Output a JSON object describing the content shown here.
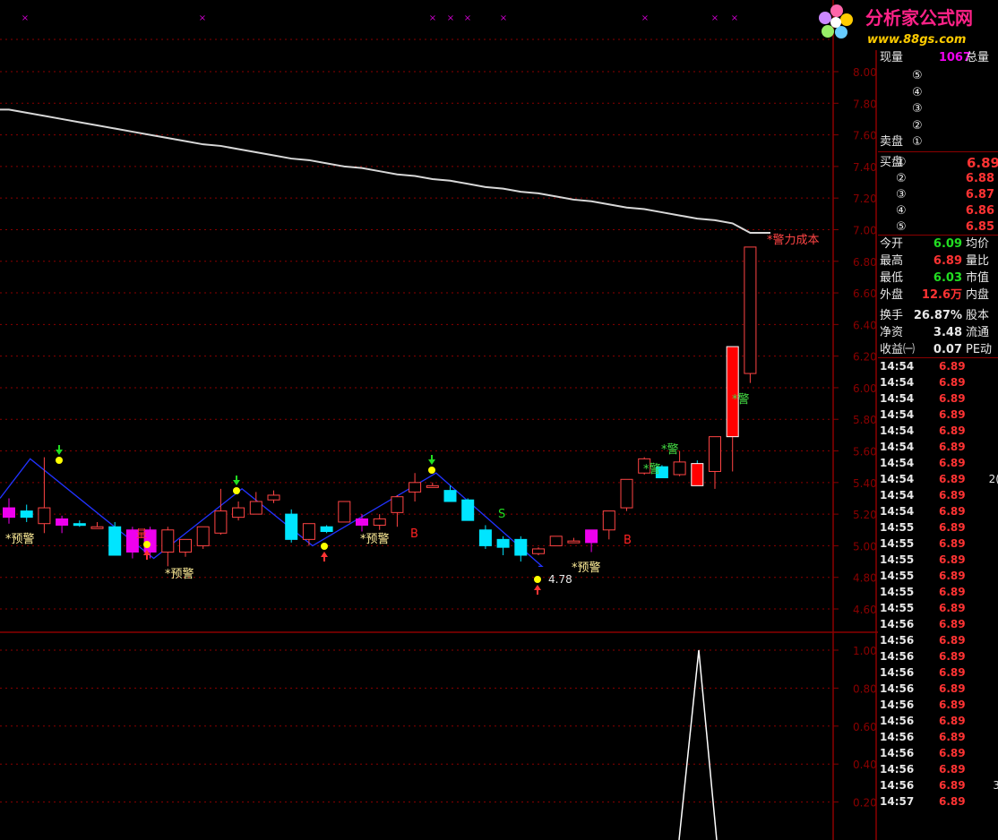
{
  "colors": {
    "up": "#ff4444",
    "down": "#00e5ff",
    "pink": "#ee00ee",
    "grid": "#8b0000",
    "ma": "#d8d8d8"
  },
  "logo": {
    "title": "分析家公式网",
    "url": "www.88gs.com"
  },
  "price_axis": [
    "8.00",
    "7.80",
    "7.60",
    "7.40",
    "7.20",
    "7.00",
    "6.80",
    "6.60",
    "6.40",
    "6.20",
    "6.00",
    "5.80",
    "5.60",
    "5.40",
    "5.20",
    "5.00",
    "4.80",
    "4.60"
  ],
  "indicator_axis": [
    "1.00",
    "0.80",
    "0.60",
    "0.40",
    "0.20"
  ],
  "annotations": {
    "warn": "*预警",
    "alert": "*警",
    "cost": "*警力成本",
    "low_value": "4.78",
    "buy": "B",
    "sell": "S",
    "volume_mark": "量"
  },
  "quote": {
    "current_vol_label": "现量",
    "current_vol": "1067",
    "total_vol_label": "总量",
    "sell_label": "卖盘",
    "buy_label": "买盘",
    "sell_levels": [
      "⑤",
      "④",
      "③",
      "②",
      "①"
    ],
    "buy_levels": [
      {
        "n": "①",
        "price": "6.89"
      },
      {
        "n": "②",
        "price": "6.88"
      },
      {
        "n": "③",
        "price": "6.87"
      },
      {
        "n": "④",
        "price": "6.86"
      },
      {
        "n": "⑤",
        "price": "6.85"
      }
    ],
    "stats": [
      {
        "label": "今开",
        "value": "6.09",
        "color": "#22dd22",
        "label2": "均价"
      },
      {
        "label": "最高",
        "value": "6.89",
        "color": "#ff3333",
        "label2": "量比"
      },
      {
        "label": "最低",
        "value": "6.03",
        "color": "#22dd22",
        "label2": "市值"
      },
      {
        "label": "外盘",
        "value": "12.6万",
        "color": "#ff3333",
        "label2": "内盘"
      },
      {
        "label": "换手",
        "value": "26.87%",
        "color": "#e8e8e8",
        "label2": "股本"
      },
      {
        "label": "净资",
        "value": "3.48",
        "color": "#e8e8e8",
        "label2": "流通"
      },
      {
        "label": "收益㈠",
        "value": "0.07",
        "color": "#e8e8e8",
        "label2": "PE动"
      }
    ],
    "ticks": [
      {
        "t": "14:54",
        "p": "6.89",
        "v": ""
      },
      {
        "t": "14:54",
        "p": "6.89",
        "v": ""
      },
      {
        "t": "14:54",
        "p": "6.89",
        "v": ""
      },
      {
        "t": "14:54",
        "p": "6.89",
        "v": ""
      },
      {
        "t": "14:54",
        "p": "6.89",
        "v": ""
      },
      {
        "t": "14:54",
        "p": "6.89",
        "v": ""
      },
      {
        "t": "14:54",
        "p": "6.89",
        "v": ""
      },
      {
        "t": "14:54",
        "p": "6.89",
        "v": "2("
      },
      {
        "t": "14:54",
        "p": "6.89",
        "v": ""
      },
      {
        "t": "14:54",
        "p": "6.89",
        "v": ""
      },
      {
        "t": "14:55",
        "p": "6.89",
        "v": ""
      },
      {
        "t": "14:55",
        "p": "6.89",
        "v": ""
      },
      {
        "t": "14:55",
        "p": "6.89",
        "v": ""
      },
      {
        "t": "14:55",
        "p": "6.89",
        "v": ""
      },
      {
        "t": "14:55",
        "p": "6.89",
        "v": ""
      },
      {
        "t": "14:55",
        "p": "6.89",
        "v": ""
      },
      {
        "t": "14:56",
        "p": "6.89",
        "v": ""
      },
      {
        "t": "14:56",
        "p": "6.89",
        "v": ""
      },
      {
        "t": "14:56",
        "p": "6.89",
        "v": ""
      },
      {
        "t": "14:56",
        "p": "6.89",
        "v": ""
      },
      {
        "t": "14:56",
        "p": "6.89",
        "v": ""
      },
      {
        "t": "14:56",
        "p": "6.89",
        "v": ""
      },
      {
        "t": "14:56",
        "p": "6.89",
        "v": ""
      },
      {
        "t": "14:56",
        "p": "6.89",
        "v": ""
      },
      {
        "t": "14:56",
        "p": "6.89",
        "v": ""
      },
      {
        "t": "14:56",
        "p": "6.89",
        "v": ""
      },
      {
        "t": "14:56",
        "p": "6.89",
        "v": "3"
      },
      {
        "t": "14:57",
        "p": "6.89",
        "v": ""
      }
    ]
  },
  "chart_data": {
    "type": "candlestick",
    "ylim": [
      4.52,
      8.1
    ],
    "indicator_ylim": [
      0,
      1.04
    ],
    "candles": [
      {
        "o": 5.18,
        "h": 5.3,
        "l": 5.14,
        "c": 5.24
      },
      {
        "o": 5.22,
        "h": 5.26,
        "l": 5.15,
        "c": 5.18
      },
      {
        "o": 5.14,
        "h": 5.56,
        "l": 5.08,
        "c": 5.24
      },
      {
        "o": 5.17,
        "h": 5.19,
        "l": 5.08,
        "c": 5.13
      },
      {
        "o": 5.14,
        "h": 5.16,
        "l": 5.12,
        "c": 5.13
      },
      {
        "o": 5.12,
        "h": 5.15,
        "l": 5.11,
        "c": 5.12
      },
      {
        "o": 5.12,
        "h": 5.15,
        "l": 4.96,
        "c": 4.94
      },
      {
        "o": 5.1,
        "h": 5.12,
        "l": 4.92,
        "c": 4.96
      },
      {
        "o": 4.96,
        "h": 5.12,
        "l": 4.92,
        "c": 5.1
      },
      {
        "o": 4.96,
        "h": 5.12,
        "l": 4.87,
        "c": 5.1
      },
      {
        "o": 4.96,
        "h": 5.04,
        "l": 4.93,
        "c": 5.04
      },
      {
        "o": 5.0,
        "h": 5.12,
        "l": 4.98,
        "c": 5.12
      },
      {
        "o": 5.08,
        "h": 5.36,
        "l": 5.07,
        "c": 5.22
      },
      {
        "o": 5.18,
        "h": 5.28,
        "l": 5.16,
        "c": 5.24
      },
      {
        "o": 5.2,
        "h": 5.34,
        "l": 5.2,
        "c": 5.28
      },
      {
        "o": 5.29,
        "h": 5.35,
        "l": 5.27,
        "c": 5.32
      },
      {
        "o": 5.2,
        "h": 5.23,
        "l": 5.02,
        "c": 5.04
      },
      {
        "o": 5.04,
        "h": 5.14,
        "l": 5.0,
        "c": 5.14
      },
      {
        "o": 5.12,
        "h": 5.13,
        "l": 5.08,
        "c": 5.09
      },
      {
        "o": 5.15,
        "h": 5.28,
        "l": 5.15,
        "c": 5.28
      },
      {
        "o": 5.17,
        "h": 5.2,
        "l": 5.09,
        "c": 5.13
      },
      {
        "o": 5.13,
        "h": 5.2,
        "l": 5.1,
        "c": 5.17
      },
      {
        "o": 5.21,
        "h": 5.32,
        "l": 5.12,
        "c": 5.31
      },
      {
        "o": 5.34,
        "h": 5.46,
        "l": 5.28,
        "c": 5.4
      },
      {
        "o": 5.38,
        "h": 5.4,
        "l": 5.38,
        "c": 5.38
      },
      {
        "o": 5.35,
        "h": 5.38,
        "l": 5.28,
        "c": 5.28
      },
      {
        "o": 5.29,
        "h": 5.3,
        "l": 5.16,
        "c": 5.16
      },
      {
        "o": 5.1,
        "h": 5.13,
        "l": 4.98,
        "c": 5.0
      },
      {
        "o": 5.04,
        "h": 5.06,
        "l": 4.94,
        "c": 4.99
      },
      {
        "o": 5.04,
        "h": 5.06,
        "l": 4.9,
        "c": 4.94
      },
      {
        "o": 4.95,
        "h": 4.99,
        "l": 4.94,
        "c": 4.98
      },
      {
        "o": 5.0,
        "h": 5.06,
        "l": 5.0,
        "c": 5.06
      },
      {
        "o": 5.03,
        "h": 5.05,
        "l": 5.02,
        "c": 5.03
      },
      {
        "o": 5.02,
        "h": 5.08,
        "l": 4.96,
        "c": 5.1
      },
      {
        "o": 5.1,
        "h": 5.22,
        "l": 5.04,
        "c": 5.22
      },
      {
        "o": 5.24,
        "h": 5.42,
        "l": 5.22,
        "c": 5.42
      },
      {
        "o": 5.46,
        "h": 5.56,
        "l": 5.45,
        "c": 5.55
      },
      {
        "o": 5.5,
        "h": 5.51,
        "l": 5.44,
        "c": 5.43
      },
      {
        "o": 5.45,
        "h": 5.6,
        "l": 5.44,
        "c": 5.53
      },
      {
        "o": 5.52,
        "h": 5.54,
        "l": 5.38,
        "c": 5.38
      },
      {
        "o": 5.47,
        "h": 5.69,
        "l": 5.36,
        "c": 5.69
      },
      {
        "o": 5.69,
        "h": 6.14,
        "l": 5.47,
        "c": 6.26
      },
      {
        "o": 6.09,
        "h": 6.89,
        "l": 6.03,
        "c": 6.89
      }
    ],
    "ma": [
      7.76,
      7.74,
      7.72,
      7.7,
      7.68,
      7.66,
      7.64,
      7.62,
      7.6,
      7.58,
      7.56,
      7.54,
      7.53,
      7.51,
      7.49,
      7.47,
      7.45,
      7.44,
      7.42,
      7.4,
      7.39,
      7.37,
      7.35,
      7.34,
      7.32,
      7.31,
      7.29,
      7.27,
      7.26,
      7.24,
      7.23,
      7.21,
      7.19,
      7.18,
      7.16,
      7.14,
      7.13,
      7.11,
      7.09,
      7.07,
      7.06,
      7.04,
      6.98
    ],
    "zigzag": [
      [
        1,
        5.55
      ],
      [
        8,
        4.92
      ],
      [
        13,
        5.36
      ],
      [
        17,
        5.0
      ],
      [
        24,
        5.46
      ],
      [
        30,
        4.87
      ]
    ],
    "indicator": [
      0,
      0,
      0,
      0,
      0,
      0,
      0,
      0,
      0,
      0,
      0,
      0,
      0,
      0,
      0,
      0,
      0,
      0,
      0,
      0,
      0,
      0,
      0,
      0,
      0,
      0,
      0,
      0,
      0,
      0,
      0,
      0,
      0,
      0,
      0,
      0,
      0,
      0,
      0,
      0,
      1.0,
      0,
      0
    ]
  }
}
